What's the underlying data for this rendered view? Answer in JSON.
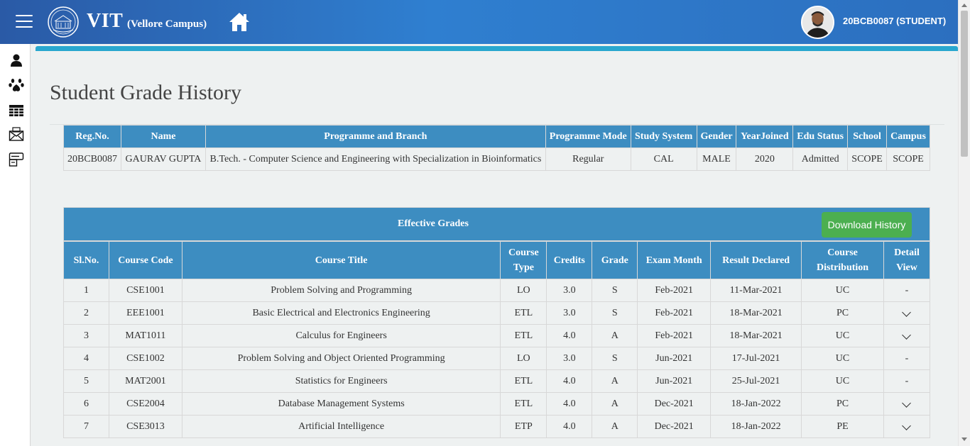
{
  "header": {
    "brand": "VIT",
    "brand_sub": "(Vellore Campus)",
    "user": "20BCB0087 (STUDENT)"
  },
  "page": {
    "title": "Student Grade History"
  },
  "student_info": {
    "columns": [
      "Reg.No.",
      "Name",
      "Programme and Branch",
      "Programme Mode",
      "Study System",
      "Gender",
      "YearJoined",
      "Edu Status",
      "School",
      "Campus"
    ],
    "row": [
      "20BCB0087",
      "GAURAV GUPTA",
      "B.Tech. - Computer Science and Engineering with Specialization in Bioinformatics",
      "Regular",
      "CAL",
      "MALE",
      "2020",
      "Admitted",
      "SCOPE",
      "SCOPE"
    ]
  },
  "grades": {
    "title": "Effective Grades",
    "download_label": "Download History",
    "columns": {
      "slno": "Sl.No.",
      "code": "Course Code",
      "title": "Course Title",
      "type_1": "Course",
      "type_2": "Type",
      "credits": "Credits",
      "grade": "Grade",
      "exam_month": "Exam Month",
      "result": "Result Declared",
      "dist_1": "Course",
      "dist_2": "Distribution",
      "detail_1": "Detail",
      "detail_2": "View"
    },
    "rows": [
      {
        "slno": "1",
        "code": "CSE1001",
        "title": "Problem Solving and Programming",
        "type": "LO",
        "credits": "3.0",
        "grade": "S",
        "exam_month": "Feb-2021",
        "result": "11-Mar-2021",
        "dist": "UC",
        "detail": "-"
      },
      {
        "slno": "2",
        "code": "EEE1001",
        "title": "Basic Electrical and Electronics Engineering",
        "type": "ETL",
        "credits": "3.0",
        "grade": "S",
        "exam_month": "Feb-2021",
        "result": "18-Mar-2021",
        "dist": "PC",
        "detail": "expand"
      },
      {
        "slno": "3",
        "code": "MAT1011",
        "title": "Calculus for Engineers",
        "type": "ETL",
        "credits": "4.0",
        "grade": "A",
        "exam_month": "Feb-2021",
        "result": "18-Mar-2021",
        "dist": "UC",
        "detail": "expand"
      },
      {
        "slno": "4",
        "code": "CSE1002",
        "title": "Problem Solving and Object Oriented Programming",
        "type": "LO",
        "credits": "3.0",
        "grade": "S",
        "exam_month": "Jun-2021",
        "result": "17-Jul-2021",
        "dist": "UC",
        "detail": "-"
      },
      {
        "slno": "5",
        "code": "MAT2001",
        "title": "Statistics for Engineers",
        "type": "ETL",
        "credits": "4.0",
        "grade": "A",
        "exam_month": "Jun-2021",
        "result": "25-Jul-2021",
        "dist": "UC",
        "detail": "-"
      },
      {
        "slno": "6",
        "code": "CSE2004",
        "title": "Database Management Systems",
        "type": "ETL",
        "credits": "4.0",
        "grade": "A",
        "exam_month": "Dec-2021",
        "result": "18-Jan-2022",
        "dist": "PC",
        "detail": "expand"
      },
      {
        "slno": "7",
        "code": "CSE3013",
        "title": "Artificial Intelligence",
        "type": "ETP",
        "credits": "4.0",
        "grade": "A",
        "exam_month": "Dec-2021",
        "result": "18-Jan-2022",
        "dist": "PE",
        "detail": "expand"
      }
    ]
  },
  "sidebar": {
    "icons": [
      "user-icon",
      "paw-icon",
      "table-icon",
      "mail-icon",
      "card-icon"
    ]
  },
  "colors": {
    "header_gradient_start": "#2a5aa6",
    "header_gradient_end": "#2f7fd0",
    "table_header": "#3d8dc1",
    "accent_bar": "#29a7cf",
    "download_button": "#4caf50",
    "page_background": "#eef1f1"
  }
}
